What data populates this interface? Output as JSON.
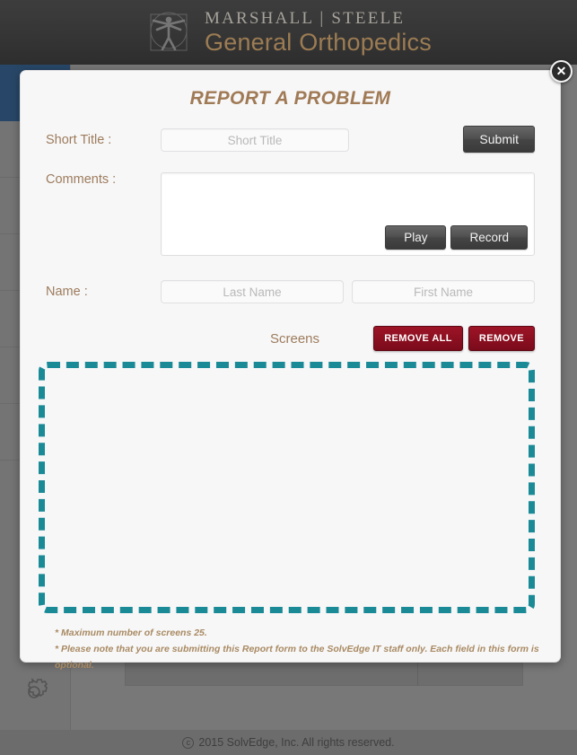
{
  "header": {
    "logo_icon": "vitruvian-man-icon",
    "brand_primary": "MARSHALL | STEELE",
    "brand_secondary": "General Orthopedics"
  },
  "sidebar": {
    "items": [
      {
        "label": "",
        "icon": "chevron-left-icon",
        "active": true
      },
      {
        "label": "",
        "icon": "circle-icon",
        "active": false
      },
      {
        "label": "",
        "icon": "circle-icon",
        "active": false
      },
      {
        "label": "",
        "icon": "circle-icon",
        "active": false
      },
      {
        "label": "",
        "icon": "circle-icon",
        "active": false
      },
      {
        "label": "",
        "icon": "circle-icon",
        "active": false
      },
      {
        "label": "",
        "icon": "circle-icon",
        "active": false
      }
    ],
    "settings_icon": "gear-icon"
  },
  "modal": {
    "title": "REPORT A PROBLEM",
    "close_icon": "close-icon",
    "short_title": {
      "label": "Short Title :",
      "placeholder": "Short Title",
      "value": ""
    },
    "submit_label": "Submit",
    "comments": {
      "label": "Comments :",
      "placeholder": "",
      "value": "",
      "play_label": "Play",
      "record_label": "Record"
    },
    "name": {
      "label": "Name :",
      "last_placeholder": "Last Name",
      "last_value": "",
      "first_placeholder": "First Name",
      "first_value": ""
    },
    "screens": {
      "label": "Screens",
      "remove_all_label": "REMOVE ALL",
      "remove_label": "REMOVE",
      "dropzone_name": "screens-dropzone"
    },
    "notes": [
      "* Maximum number of screens 25.",
      "* Please note that you are submitting this Report form to the SolvEdge IT staff only. Each field in this form is optional."
    ]
  },
  "footer": {
    "copyright_symbol": "c",
    "copyright": "2015 SolvEdge, Inc.  All rights reserved."
  },
  "colors": {
    "brand_gold": "#c2945a",
    "label_brown": "#9d7c5c",
    "sidebar_active": "#1c4877",
    "dropzone_teal": "#1a8a96",
    "danger_red": "#8c0f20"
  }
}
